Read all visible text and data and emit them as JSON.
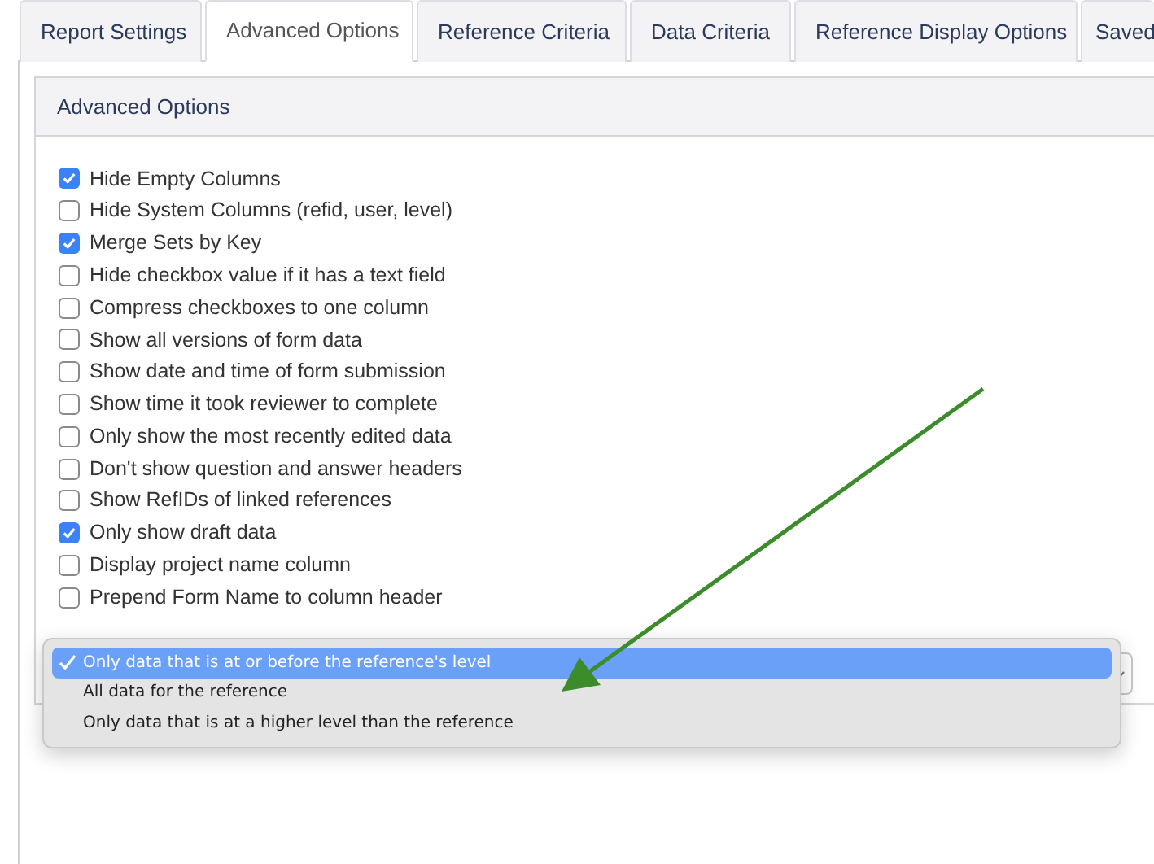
{
  "tabs": [
    {
      "label": "Report Settings",
      "selected": false
    },
    {
      "label": "Advanced Options",
      "selected": true
    },
    {
      "label": "Reference Criteria",
      "selected": false
    },
    {
      "label": "Data Criteria",
      "selected": false
    },
    {
      "label": "Reference Display Options",
      "selected": false
    },
    {
      "label": "Saved",
      "selected": false
    }
  ],
  "panel": {
    "title": "Advanced Options",
    "options": [
      {
        "label": "Hide Empty Columns",
        "checked": true
      },
      {
        "label": "Hide System Columns (refid, user, level)",
        "checked": false
      },
      {
        "label": "Merge Sets by Key",
        "checked": true
      },
      {
        "label": "Hide checkbox value if it has a text field",
        "checked": false
      },
      {
        "label": "Compress checkboxes to one column",
        "checked": false
      },
      {
        "label": "Show all versions of form data",
        "checked": false
      },
      {
        "label": "Show date and time of form submission",
        "checked": false
      },
      {
        "label": "Show time it took reviewer to complete",
        "checked": false
      },
      {
        "label": "Only show the most recently edited data",
        "checked": false
      },
      {
        "label": "Don't show question and answer headers",
        "checked": false
      },
      {
        "label": "Show RefIDs of linked references",
        "checked": false
      },
      {
        "label": "Only show draft data",
        "checked": true
      },
      {
        "label": "Display project name column",
        "checked": false
      },
      {
        "label": "Prepend Form Name to column header",
        "checked": false
      }
    ],
    "dropdown": {
      "expanded": true,
      "options": [
        {
          "label": "Only data that is at or before the reference's level",
          "selected": true
        },
        {
          "label": "All data for the reference",
          "selected": false
        },
        {
          "label": "Only data that is at a higher level than the reference",
          "selected": false
        }
      ]
    }
  }
}
